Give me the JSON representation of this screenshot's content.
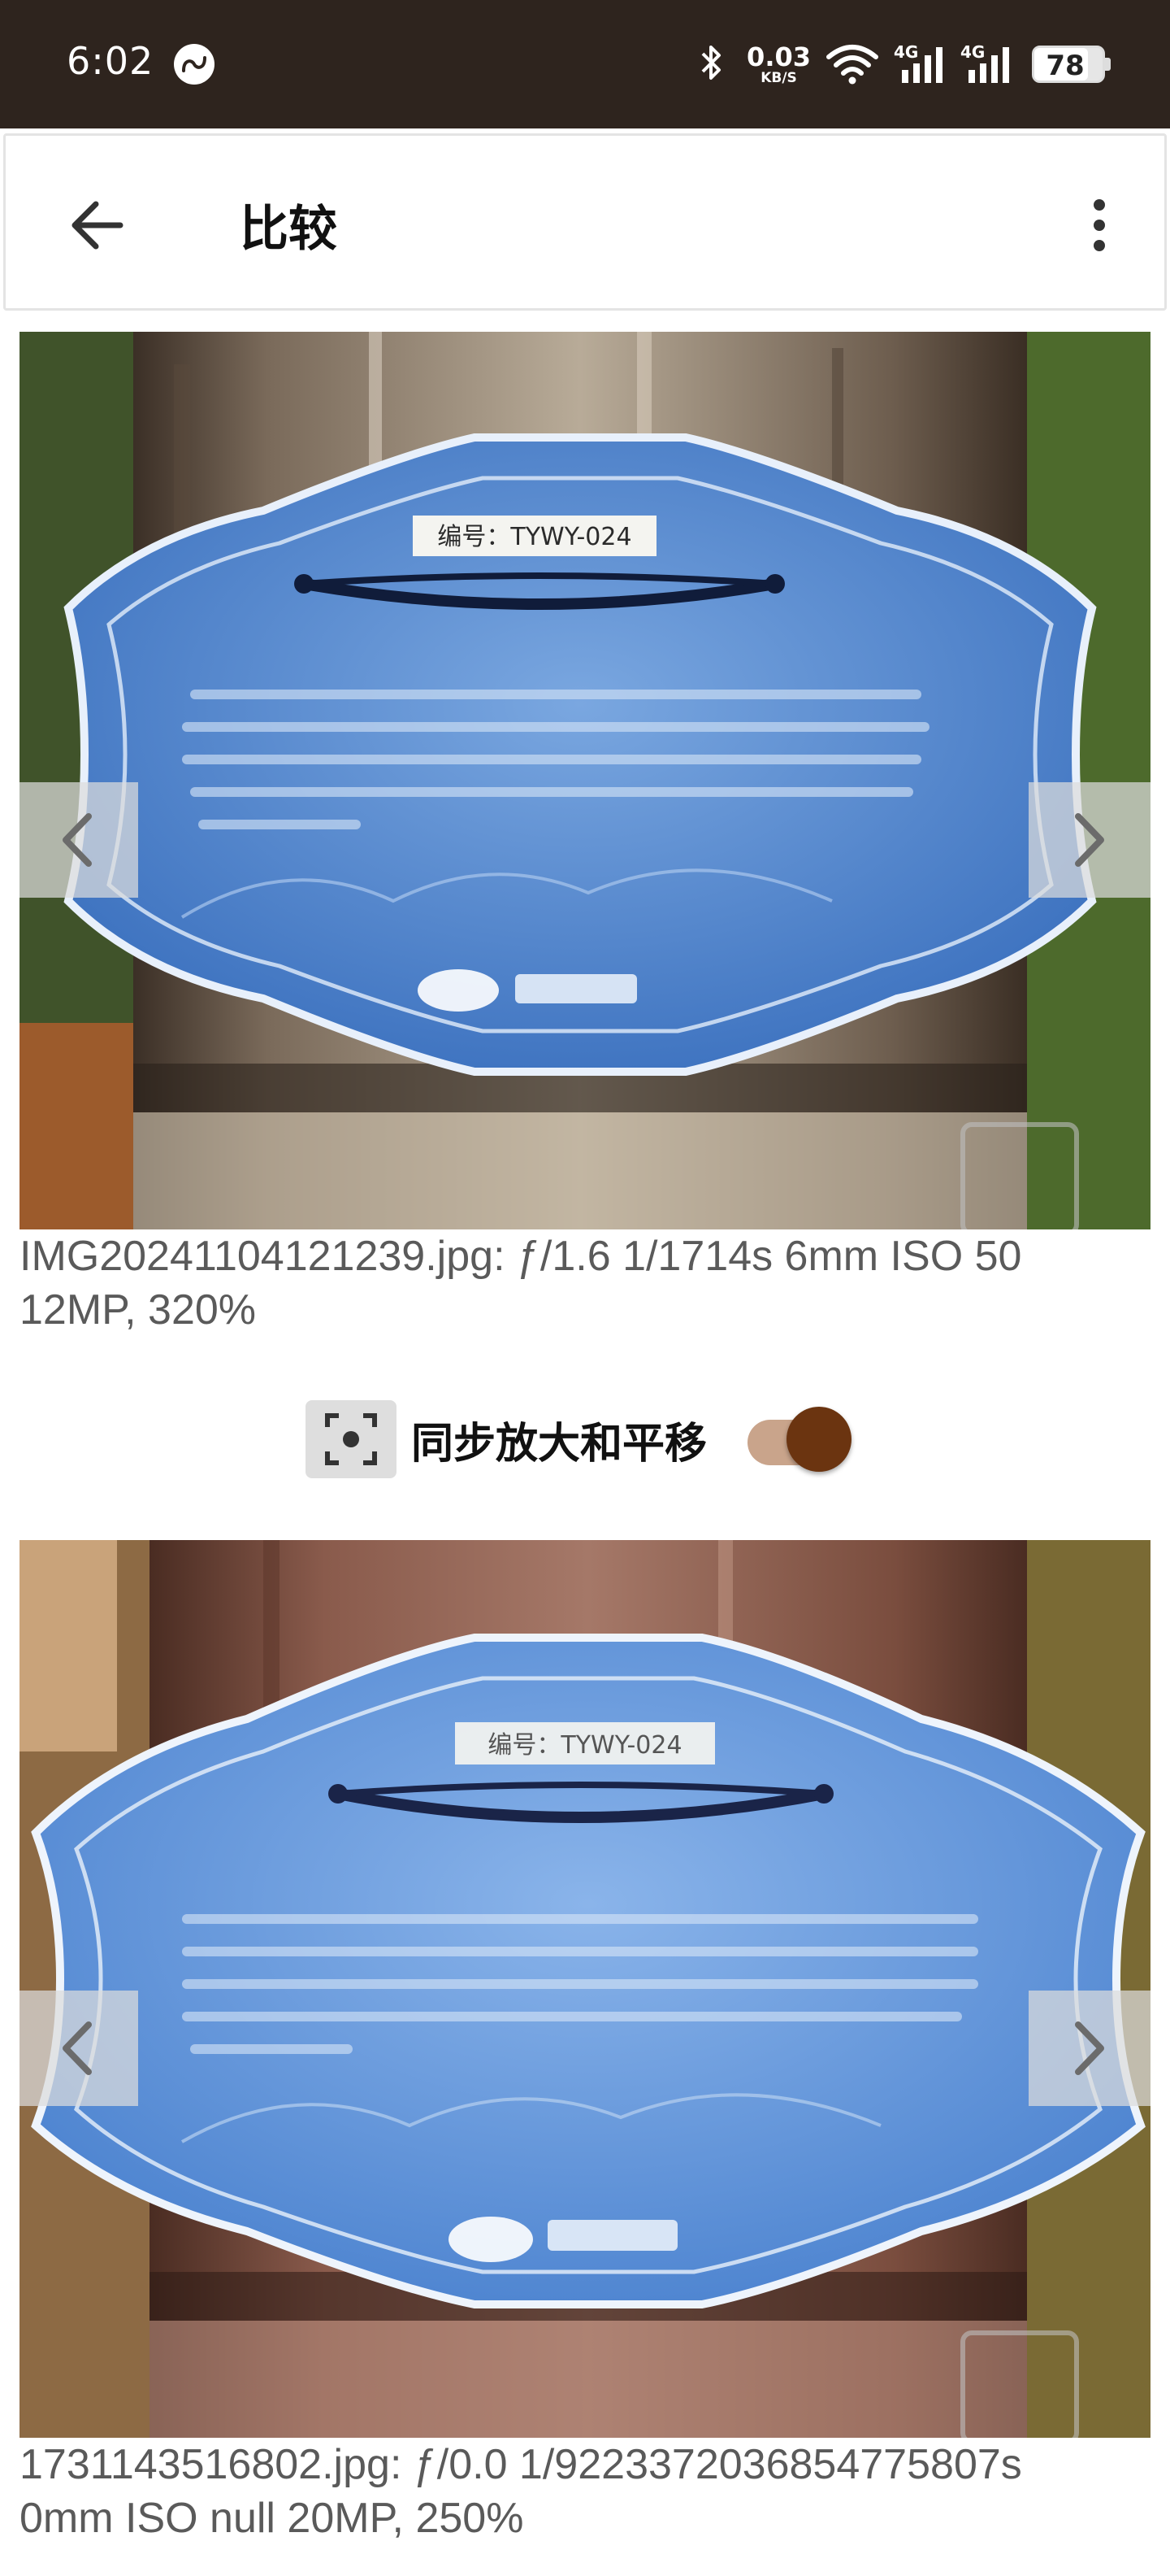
{
  "status_bar": {
    "time": "6:02",
    "net_speed_value": "0.03",
    "net_speed_unit": "KB/S",
    "signal_1_label": "4G",
    "signal_2_label": "4G",
    "battery": "78",
    "icons": [
      "app-notification-icon",
      "bluetooth-icon",
      "wifi-icon",
      "cell-signal-icon",
      "cell-signal-icon",
      "battery-icon"
    ]
  },
  "app_bar": {
    "title": "比较",
    "back_icon": "arrow-left-icon",
    "more_icon": "more-vertical-icon"
  },
  "panel_1": {
    "sign_id": "编号：TYWY-024",
    "caption": "IMG20241104121239.jpg: ƒ/1.6 1/1714s 6mm ISO 50\n12MP, 320%"
  },
  "sync": {
    "label": "同步放大和平移",
    "enabled": true
  },
  "panel_2": {
    "sign_id": "编号：TYWY-024",
    "caption": "1731143516802.jpg: ƒ/0.0 1/9223372036854775807s\n0mm ISO null 20MP, 250%"
  },
  "colors": {
    "status_bar_bg": "#2e241e",
    "sign_blue": "#4f86d0",
    "toggle_thumb": "#6b3410",
    "toggle_track": "#c9a48b",
    "caption_text": "#5a5a5a"
  }
}
